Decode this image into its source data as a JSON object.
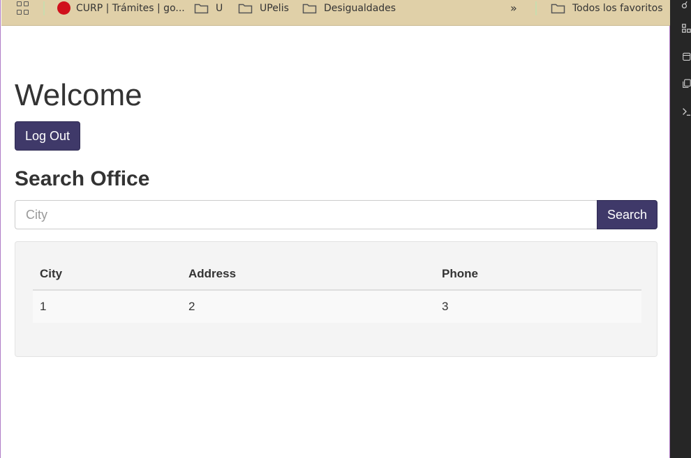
{
  "bookmarks": {
    "items": [
      {
        "label": "CURP | Trámites | go..."
      },
      {
        "label": "U"
      },
      {
        "label": "UPelis"
      },
      {
        "label": "Desigualdades"
      },
      {
        "label": "Todos los favoritos"
      }
    ]
  },
  "main": {
    "title": "Welcome",
    "logout_label": "Log Out",
    "section_title": "Search Office",
    "search": {
      "placeholder": "City",
      "value": "",
      "button_label": "Search"
    },
    "table": {
      "headers": [
        "City",
        "Address",
        "Phone"
      ],
      "rows": [
        [
          "1",
          "2",
          "3"
        ]
      ]
    }
  },
  "colors": {
    "accent": "#3f3969",
    "bookmarks_bar": "#e0d0a8",
    "well": "#f4f4f4",
    "side_panel": "#262626"
  },
  "icons": [
    "apps-grid-icon",
    "site-favicon",
    "folder-icon",
    "chevron-double-right-icon"
  ]
}
